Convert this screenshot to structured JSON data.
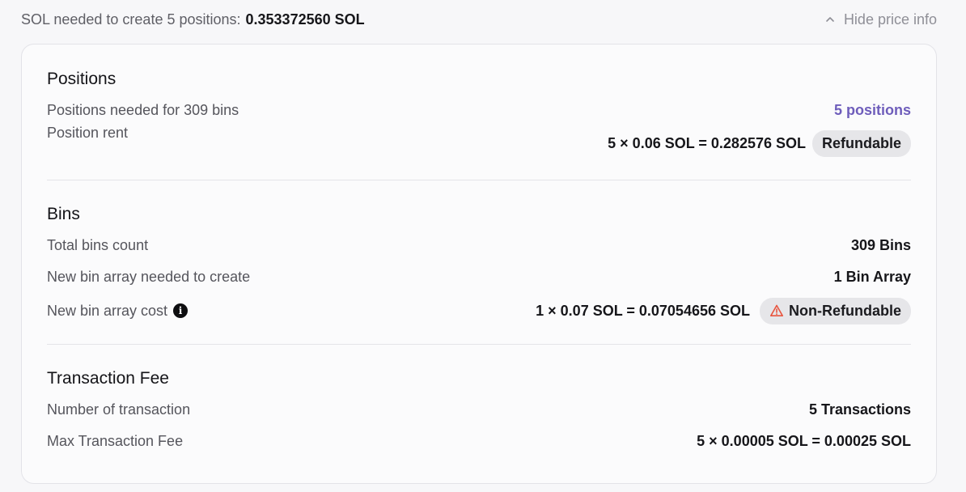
{
  "header": {
    "label": "SOL needed to create 5 positions:",
    "total": "0.353372560 SOL",
    "toggle_label": "Hide price info"
  },
  "positions": {
    "title": "Positions",
    "rows": [
      {
        "label": "Positions needed for 309 bins",
        "value": "5 positions"
      },
      {
        "label": "Position rent",
        "value": "5 × 0.06 SOL = 0.282576 SOL",
        "badge": "Refundable"
      }
    ]
  },
  "bins": {
    "title": "Bins",
    "rows": [
      {
        "label": "Total bins count",
        "value": "309 Bins"
      },
      {
        "label": "New bin array needed to create",
        "value": "1 Bin Array"
      },
      {
        "label": "New bin array cost",
        "value": "1 × 0.07 SOL = 0.07054656 SOL",
        "badge": "Non-Refundable",
        "info_glyph": "i"
      }
    ]
  },
  "fee": {
    "title": "Transaction Fee",
    "rows": [
      {
        "label": "Number of transaction",
        "value": "5 Transactions"
      },
      {
        "label": "Max Transaction Fee",
        "value": "5 × 0.00005 SOL = 0.00025 SOL"
      }
    ]
  },
  "colors": {
    "accent": "#6e5dbb",
    "warning": "#e8553f",
    "badge_bg": "#e6e6e9"
  },
  "icons": [
    "chevron-up-icon",
    "info-icon",
    "warning-triangle-icon"
  ]
}
